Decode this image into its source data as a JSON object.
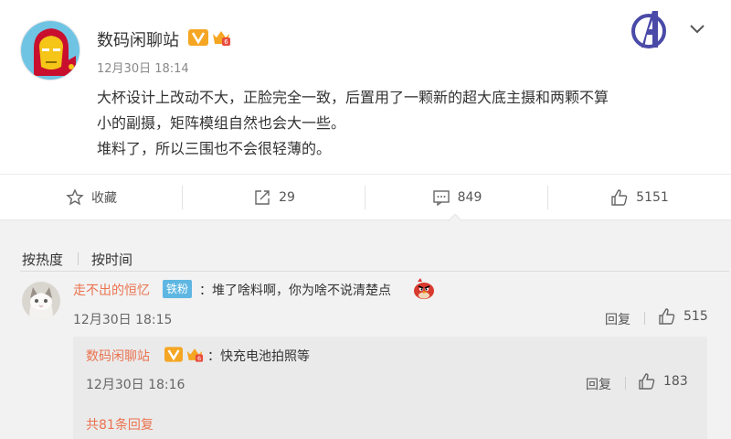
{
  "post": {
    "author": "数码闲聊站",
    "time": "12月30日 18:14",
    "lines": [
      "大杯设计上改动不大，正脸完全一致，后置用了一颗新的超大底主摄和两颗不算",
      "小的副摄，矩阵模组自然也会大一些。",
      "堆料了，所以三围也不会很轻薄的。"
    ],
    "icons": {
      "verified": "v-verified-badge",
      "vip": "crown-vip-icon",
      "decoration": "avengers-logo",
      "menu": "chevron-down-icon"
    }
  },
  "actions": {
    "favorite_label": "收藏",
    "repost_count": "29",
    "comment_count": "849",
    "like_count": "5151"
  },
  "comments": {
    "sort_hot": "按热度",
    "sort_time": "按时间",
    "items": [
      {
        "user": "走不出的恒忆",
        "tag": "铁粉",
        "text": "：堆了啥料啊，你为啥不说清楚点",
        "emoji": "angry-bird-emoji",
        "time": "12月30日 18:15",
        "reply_label": "回复",
        "likes": "515",
        "replies": [
          {
            "user": "数码闲聊站",
            "text": "：快充电池拍照等",
            "time": "12月30日 18:16",
            "reply_label": "回复",
            "likes": "183"
          }
        ],
        "more_replies": "共81条回复"
      }
    ]
  },
  "colors": {
    "accent_orange": "#eb7350",
    "tag_blue": "#5eb7e2",
    "verified_orange": "#f5a623",
    "crown_red": "#e84c3d"
  }
}
